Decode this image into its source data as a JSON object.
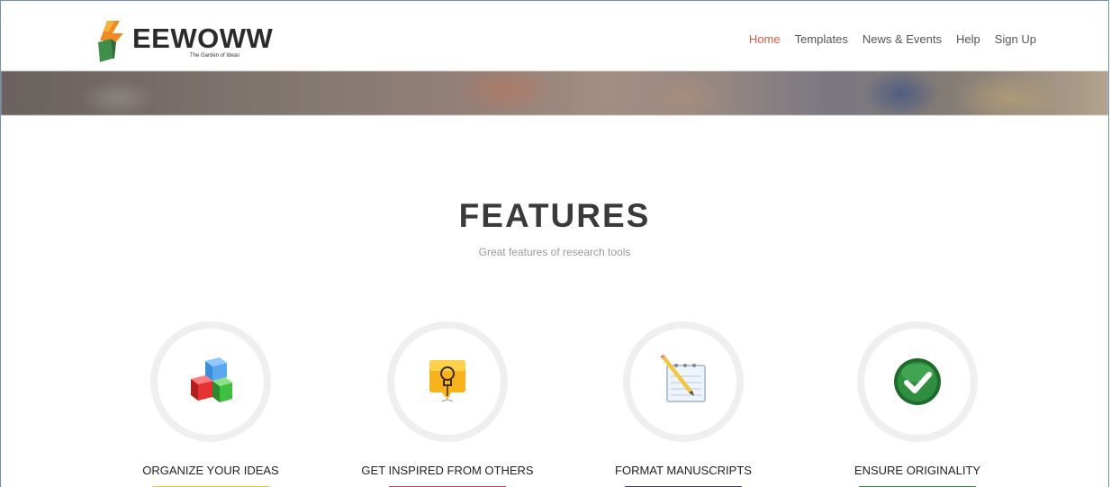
{
  "brand": {
    "name": "EEWOWW",
    "tagline": "The Garden of Ideas"
  },
  "nav": {
    "items": [
      {
        "label": "Home",
        "active": true
      },
      {
        "label": "Templates",
        "active": false
      },
      {
        "label": "News & Events",
        "active": false
      },
      {
        "label": "Help",
        "active": false
      },
      {
        "label": "Sign Up",
        "active": false
      }
    ]
  },
  "features": {
    "title": "FEATURES",
    "subtitle": "Great features of research tools",
    "items": [
      {
        "label": "ORGANIZE YOUR IDEAS",
        "icon": "cubes-icon",
        "accent": "#e8c640"
      },
      {
        "label": "GET INSPIRED FROM OTHERS",
        "icon": "lightbulb-icon",
        "accent": "#c0466a"
      },
      {
        "label": "FORMAT MANUSCRIPTS",
        "icon": "notepad-pencil-icon",
        "accent": "#3c3c78"
      },
      {
        "label": "ENSURE ORIGINALITY",
        "icon": "checkmark-icon",
        "accent": "#2e8a4a"
      }
    ]
  },
  "colors": {
    "nav_active": "#e2583e",
    "title": "#3a3a3a"
  }
}
